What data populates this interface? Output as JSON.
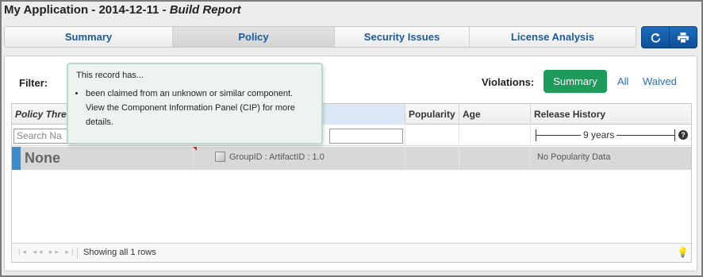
{
  "window": {
    "app_title": "My Application - 2014-12-11 - ",
    "report_name": "Build Report"
  },
  "tabs": [
    {
      "label": "Summary",
      "active": false
    },
    {
      "label": "Policy",
      "active": true
    },
    {
      "label": "Security Issues",
      "active": false
    },
    {
      "label": "License Analysis",
      "active": false
    }
  ],
  "actions": {
    "refresh_icon": "refresh-icon",
    "print_icon": "print-icon"
  },
  "filter": {
    "label": "Filter:"
  },
  "violations": {
    "label": "Violations:",
    "summary": "Summary",
    "all": "All",
    "waived": "Waived",
    "summary_color": "#1e9a5a"
  },
  "grid": {
    "headers": {
      "policy_threat": "Policy Thre",
      "popularity": "Popularity",
      "age": "Age",
      "release_history": "Release History"
    },
    "search_placeholder": "Search Na",
    "release_span": "9 years",
    "row": {
      "threat": "None",
      "component": "GroupID : ArtifactID : 1.0",
      "popularity": "No Popularity Data"
    },
    "footer": {
      "status": "Showing all 1 rows"
    }
  },
  "tooltip": {
    "header": "This record has...",
    "items": [
      "been claimed from an unknown or similar component. View the Component Information Panel (CIP) for more details."
    ]
  }
}
